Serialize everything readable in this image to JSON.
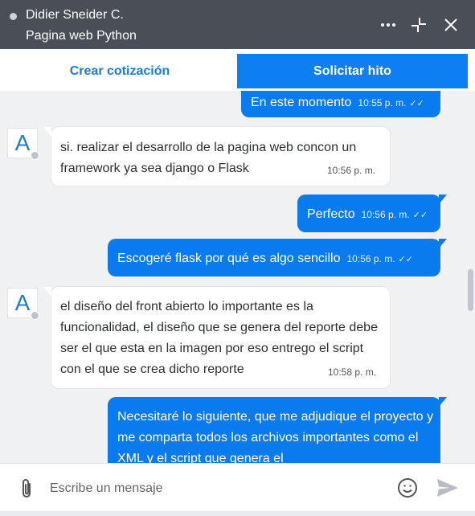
{
  "header": {
    "contact_name": "Didier Sneider C.",
    "project_name": "Pagina web Python",
    "icons": [
      "more-icon",
      "minimize-icon",
      "close-icon"
    ]
  },
  "actions": {
    "create_quote_label": "Crear cotización",
    "request_milestone_label": "Solicitar hito"
  },
  "messages": [
    {
      "direction": "out",
      "text": "En este momento",
      "time": "10:55 p. m.",
      "status": "read"
    },
    {
      "direction": "in",
      "avatar_letter": "A",
      "text": "si. realizar el desarrollo de la pagina web concon un framework ya sea django o Flask",
      "time": "10:56 p. m."
    },
    {
      "direction": "out",
      "text": "Perfecto",
      "time": "10:56 p. m.",
      "status": "read"
    },
    {
      "direction": "out",
      "text": "Escogeré flask por qué es algo sencillo",
      "time": "10:56 p. m.",
      "status": "read"
    },
    {
      "direction": "in",
      "avatar_letter": "A",
      "text": "el diseño del front abierto lo importante es la funcionalidad, el diseño que se genera del reporte debe ser el que esta en la imagen por eso entrego el script con el que se crea dicho reporte",
      "time": "10:58 p. m."
    },
    {
      "direction": "out",
      "text": "Necesitaré lo siguiente, que me adjudique el proyecto y me comparta todos los archivos importantes como el XML y el script que genera el",
      "time": "",
      "status": ""
    }
  ],
  "composer": {
    "placeholder": "Escribe un mensaje"
  },
  "colors": {
    "header_bg": "#4a4f57",
    "accent": "#0d7ff0",
    "outgoing_bubble": "#0a7bee",
    "incoming_bubble": "#ffffff",
    "chat_bg": "#f0f1f3"
  }
}
